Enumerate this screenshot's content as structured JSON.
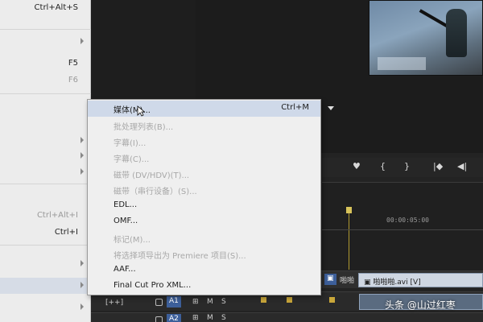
{
  "parent_menu": {
    "items": [
      {
        "shortcut": "Ctrl+Alt+S",
        "dim": false,
        "submenu": false
      },
      {
        "shortcut": "",
        "dim": false,
        "submenu": true
      },
      {
        "shortcut": "F5",
        "dim": false,
        "submenu": false
      },
      {
        "shortcut": "F6",
        "dim": true,
        "submenu": false
      },
      {
        "shortcut": "",
        "dim": false,
        "submenu": true
      },
      {
        "shortcut": "",
        "dim": false,
        "submenu": true
      },
      {
        "shortcut": "",
        "dim": false,
        "submenu": true
      },
      {
        "shortcut": "Ctrl+Alt+I",
        "dim": true,
        "submenu": false
      },
      {
        "shortcut": "Ctrl+I",
        "dim": false,
        "submenu": false
      },
      {
        "shortcut": "",
        "dim": false,
        "submenu": true
      },
      {
        "shortcut": "",
        "dim": false,
        "submenu": true
      },
      {
        "shortcut": "",
        "dim": false,
        "submenu": true
      }
    ]
  },
  "submenu": {
    "items": [
      {
        "label": "媒体(M)...",
        "shortcut": "Ctrl+M",
        "disabled": false,
        "highlighted": true
      },
      {
        "label": "批处理列表(B)...",
        "shortcut": "",
        "disabled": true
      },
      {
        "label": "字幕(I)...",
        "shortcut": "",
        "disabled": true
      },
      {
        "label": "字幕(C)...",
        "shortcut": "",
        "disabled": true
      },
      {
        "label": "磁带 (DV/HDV)(T)...",
        "shortcut": "",
        "disabled": true
      },
      {
        "label": "磁带（串行设备）(S)...",
        "shortcut": "",
        "disabled": true
      },
      {
        "label": "EDL...",
        "shortcut": "",
        "disabled": false
      },
      {
        "label": "OMF...",
        "shortcut": "",
        "disabled": false
      },
      {
        "label": "标记(M)...",
        "shortcut": "",
        "disabled": true
      },
      {
        "label": "将选择项导出为 Premiere 项目(S)...",
        "shortcut": "",
        "disabled": true
      },
      {
        "label": "AAF...",
        "shortcut": "",
        "disabled": false
      },
      {
        "label": "Final Cut Pro XML...",
        "shortcut": "",
        "disabled": false
      }
    ]
  },
  "timeline": {
    "timecode": "00:00:05:00",
    "clip_name": "啪啪啪.avi [V]",
    "track_v_label": "啪啪",
    "track_a1_label": "A1",
    "track_a2_label": "A2",
    "mute_label": "M",
    "solo_label": "S",
    "add_label": "[++]"
  },
  "transport": {
    "marker": "♥",
    "in_point": "{",
    "out_point": "}",
    "go_in": "|◆",
    "step_back": "◀|"
  },
  "watermark": "头条 @山过红枣"
}
